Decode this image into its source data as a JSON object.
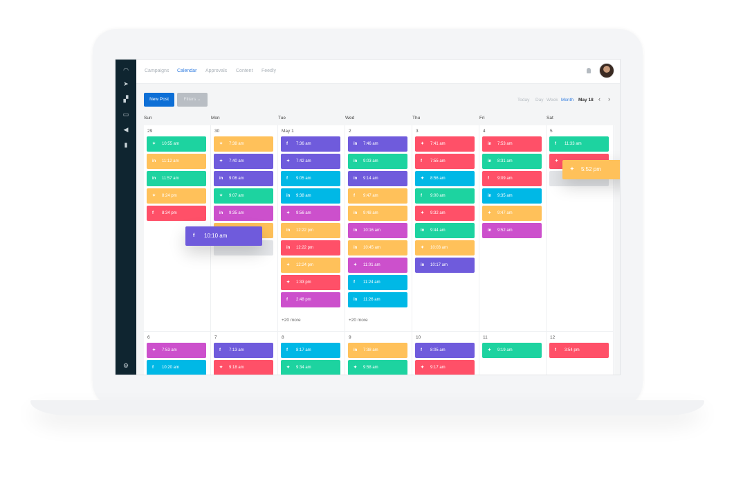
{
  "colors": {
    "green": "#1dd3a0",
    "orange": "#ffc15a",
    "red": "#ff5068",
    "purple": "#6f5bdc",
    "cyan": "#00b8e6",
    "magenta": "#cc50cc",
    "gray": "#e4e6e9",
    "accent": "#0d6fd6"
  },
  "sidebar": {
    "icons": [
      "dashboard-icon",
      "send-icon",
      "messages-icon",
      "inbox-icon",
      "megaphone-icon",
      "analytics-icon"
    ],
    "bottom_icon": "gear-icon"
  },
  "topnav": {
    "tabs": [
      {
        "label": "Campaigns"
      },
      {
        "label": "Calendar",
        "active": true
      },
      {
        "label": "Approvals"
      },
      {
        "label": "Content"
      },
      {
        "label": "Feedly"
      }
    ]
  },
  "toolbar": {
    "new_post": "New Post",
    "filters": "Filters",
    "today": "Today",
    "day": "Day",
    "week": "Week",
    "month": "Month",
    "current": "May 18",
    "prev": "‹",
    "next": "›"
  },
  "days": [
    "Sun",
    "Mon",
    "Tue",
    "Wed",
    "Thu",
    "Fri",
    "Sat"
  ],
  "weeks": [
    [
      {
        "date": "29",
        "events": [
          [
            "tw",
            "10:55 am",
            "green"
          ],
          [
            "in",
            "11:12 am",
            "orange"
          ],
          [
            "in",
            "11:57 am",
            "green"
          ],
          [
            "tw",
            "8:24 pm",
            "orange"
          ],
          [
            "f",
            "8:34 pm",
            "red"
          ]
        ]
      },
      {
        "date": "30",
        "events": [
          [
            "tw",
            "7:38 am",
            "orange"
          ],
          [
            "tw",
            "7:40 am",
            "purple"
          ],
          [
            "in",
            "9:06 am",
            "purple"
          ],
          [
            "tw",
            "9:07 am",
            "green"
          ],
          [
            "in",
            "9:35 am",
            "magenta"
          ],
          [
            "",
            "",
            "orange"
          ],
          [
            "",
            "",
            "gray"
          ]
        ]
      },
      {
        "date": "May 1",
        "events": [
          [
            "f",
            "7:36 am",
            "purple"
          ],
          [
            "tw",
            "7:42 am",
            "purple"
          ],
          [
            "f",
            "9:05 am",
            "cyan"
          ],
          [
            "in",
            "9:38 am",
            "cyan"
          ],
          [
            "tw",
            "9:56 am",
            "magenta"
          ],
          [
            "in",
            "12:22 pm",
            "orange"
          ],
          [
            "in",
            "12:22 pm",
            "red"
          ],
          [
            "tw",
            "12:24 pm",
            "orange"
          ],
          [
            "tw",
            "1:33 pm",
            "red"
          ],
          [
            "f",
            "2:48 pm",
            "magenta"
          ]
        ],
        "more": "+20 more"
      },
      {
        "date": "2",
        "events": [
          [
            "in",
            "7:46 am",
            "purple"
          ],
          [
            "in",
            "9:03 am",
            "green"
          ],
          [
            "in",
            "9:14 am",
            "purple"
          ],
          [
            "f",
            "9:47 am",
            "orange"
          ],
          [
            "in",
            "9:48 am",
            "orange"
          ],
          [
            "in",
            "10:16 am",
            "magenta"
          ],
          [
            "in",
            "10:45 am",
            "orange"
          ],
          [
            "tw",
            "11:01 am",
            "magenta"
          ],
          [
            "f",
            "11:24 am",
            "cyan"
          ],
          [
            "in",
            "11:26 am",
            "cyan"
          ]
        ],
        "more": "+20 more"
      },
      {
        "date": "3",
        "events": [
          [
            "tw",
            "7:41 am",
            "red"
          ],
          [
            "f",
            "7:55 am",
            "red"
          ],
          [
            "tw",
            "8:56 am",
            "cyan"
          ],
          [
            "f",
            "9:00 am",
            "green"
          ],
          [
            "tw",
            "9:32 am",
            "red"
          ],
          [
            "in",
            "9:44 am",
            "green"
          ],
          [
            "tw",
            "10:03 am",
            "orange"
          ],
          [
            "in",
            "10:17 am",
            "purple"
          ]
        ]
      },
      {
        "date": "4",
        "events": [
          [
            "in",
            "7:53 am",
            "red"
          ],
          [
            "in",
            "8:31 am",
            "green"
          ],
          [
            "f",
            "9:09 am",
            "red"
          ],
          [
            "in",
            "9:35 am",
            "cyan"
          ],
          [
            "tw",
            "9:47 am",
            "orange"
          ],
          [
            "in",
            "9:52 am",
            "magenta"
          ]
        ]
      },
      {
        "date": "5",
        "events": [
          [
            "f",
            "11:33 am",
            "green"
          ],
          [
            "tw",
            "",
            "red"
          ],
          [
            "",
            "",
            "gray"
          ]
        ]
      }
    ],
    [
      {
        "date": "6",
        "events": [
          [
            "tw",
            "7:53 am",
            "magenta"
          ],
          [
            "f",
            "10:20 am",
            "cyan"
          ]
        ]
      },
      {
        "date": "7",
        "events": [
          [
            "f",
            "7:13 am",
            "purple"
          ],
          [
            "tw",
            "9:18 am",
            "red"
          ]
        ]
      },
      {
        "date": "8",
        "events": [
          [
            "f",
            "8:17 am",
            "cyan"
          ],
          [
            "tw",
            "9:34 am",
            "green"
          ]
        ]
      },
      {
        "date": "9",
        "events": [
          [
            "in",
            "7:38 am",
            "orange"
          ],
          [
            "tw",
            "9:58 am",
            "green"
          ]
        ]
      },
      {
        "date": "10",
        "events": [
          [
            "f",
            "8:05 am",
            "purple"
          ],
          [
            "tw",
            "9:17 am",
            "red"
          ]
        ]
      },
      {
        "date": "11",
        "events": [
          [
            "tw",
            "9:19 am",
            "green"
          ]
        ]
      },
      {
        "date": "12",
        "events": [
          [
            "f",
            "3:54 pm",
            "red"
          ]
        ]
      }
    ]
  ],
  "dragging": [
    {
      "icon": "f",
      "time": "10:10 am",
      "color": "purple"
    },
    {
      "icon": "tw",
      "time": "5:52 pm",
      "color": "orange"
    }
  ]
}
